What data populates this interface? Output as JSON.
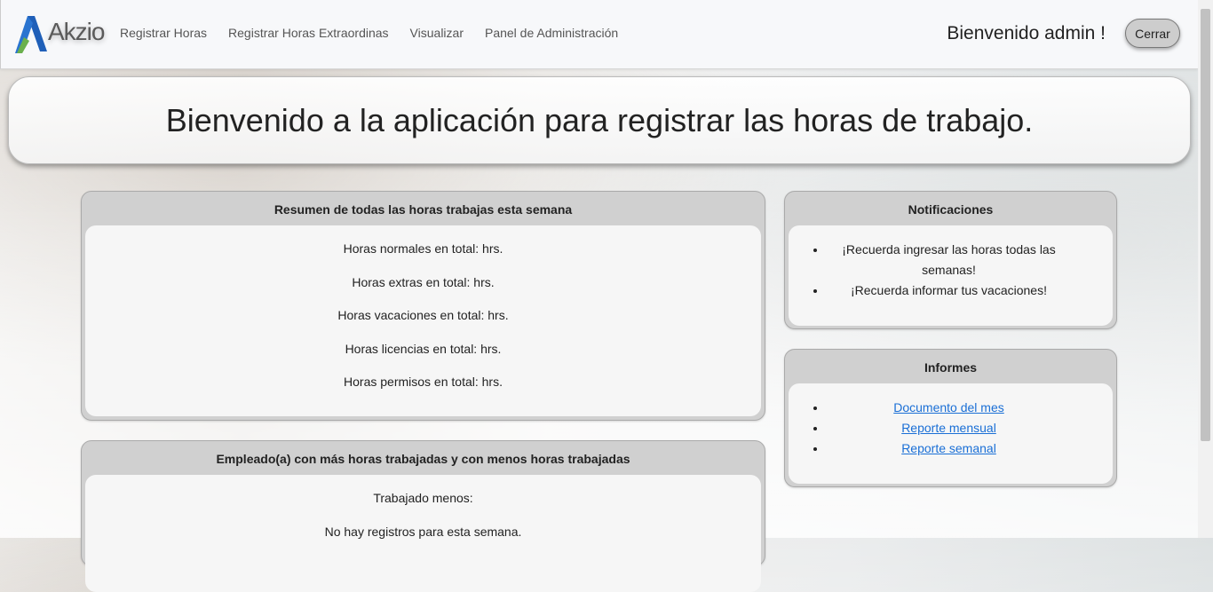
{
  "navbar": {
    "logo_text": "Akzio",
    "links": [
      "Registrar Horas",
      "Registrar Horas Extraordinas",
      "Visualizar",
      "Panel de Administración"
    ],
    "welcome": "Bienvenido admin !",
    "logout_label": "Cerrar"
  },
  "hero": {
    "title": "Bienvenido a la aplicación para registrar las horas de trabajo."
  },
  "summary": {
    "title": "Resumen de todas las horas trabajas esta semana",
    "lines": [
      "Horas normales en total: hrs.",
      "Horas extras en total: hrs.",
      "Horas vacaciones en total: hrs.",
      "Horas licencias en total: hrs.",
      "Horas permisos en total: hrs."
    ]
  },
  "employee": {
    "title": "Empleado(a) con más horas trabajadas y con menos horas trabajadas",
    "lines": [
      "Trabajado menos:",
      "No hay registros para esta semana."
    ]
  },
  "notifications": {
    "title": "Notificaciones",
    "items": [
      "¡Recuerda ingresar las horas todas las semanas!",
      "¡Recuerda informar tus vacaciones!"
    ]
  },
  "reports": {
    "title": "Informes",
    "links": [
      "Documento del mes",
      "Reporte mensual",
      "Reporte semanal"
    ]
  },
  "colors": {
    "accent_link": "#1a6fd6",
    "logo_blue": "#1f5fb8",
    "logo_green": "#6ab04c"
  }
}
